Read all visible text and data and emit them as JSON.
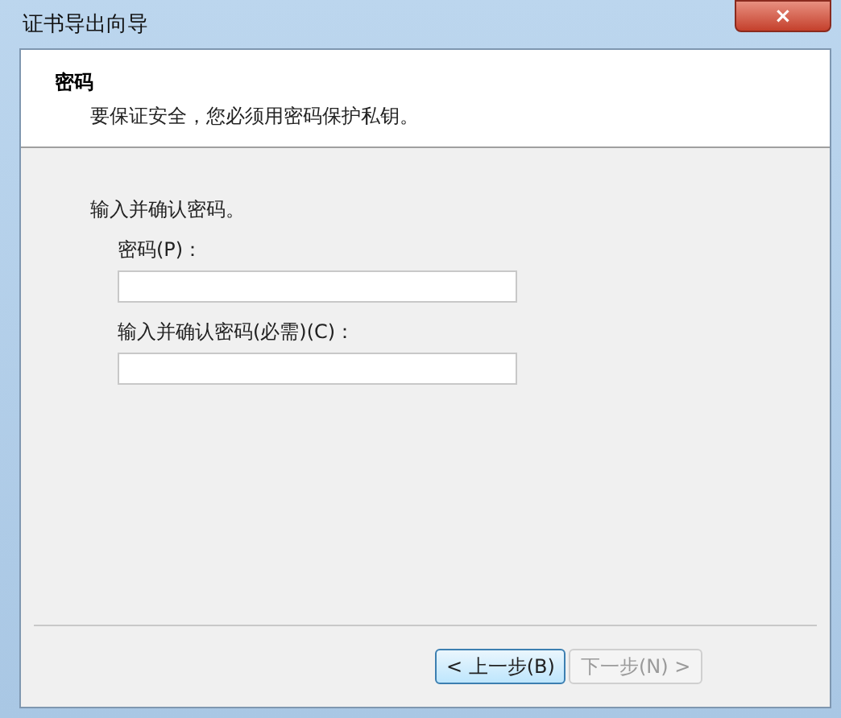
{
  "window": {
    "title": "证书导出向导",
    "close": "×"
  },
  "header": {
    "title": "密码",
    "subtitle": "要保证安全，您必须用密码保护私钥。"
  },
  "intro": "输入并确认密码。",
  "fields": [
    {
      "label": "密码(P)："
    },
    {
      "label": "输入并确认密码(必需)(C)："
    }
  ],
  "buttons": [
    {
      "label": "< 上一步(B)",
      "disabled": false,
      "focused": true
    },
    {
      "label": "下一步(N) >",
      "disabled": true,
      "focused": false
    }
  ]
}
